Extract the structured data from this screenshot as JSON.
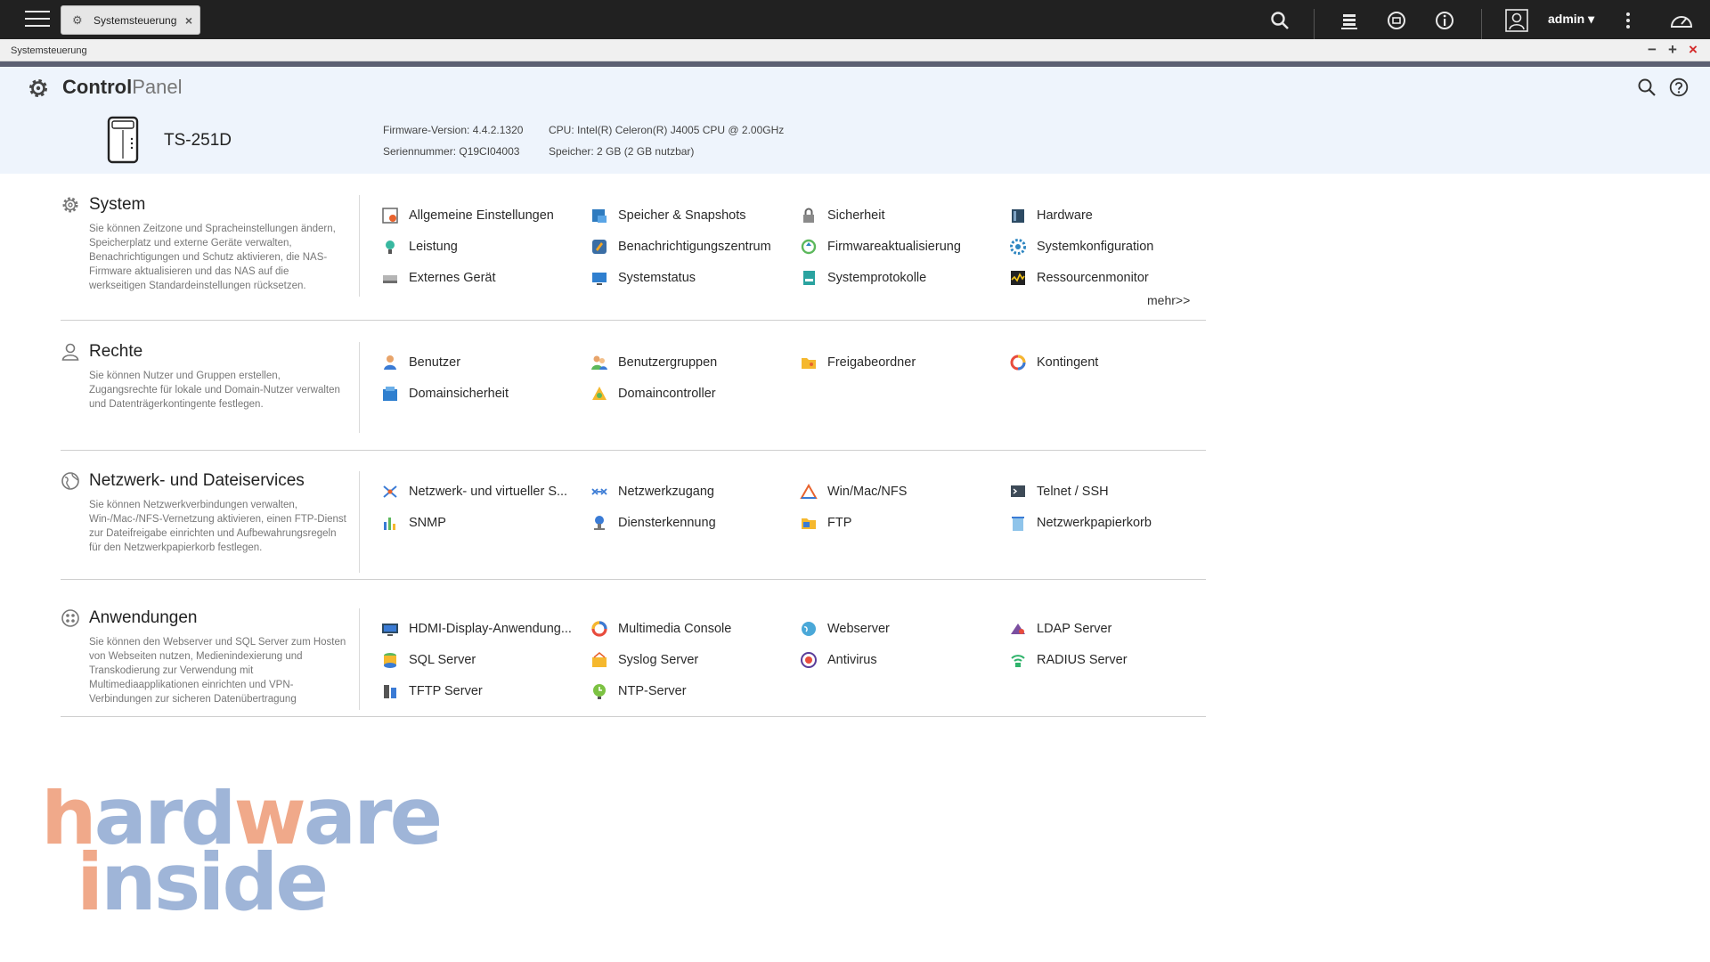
{
  "taskbar": {
    "tab_label": "Systemsteuerung",
    "user": "admin ▾"
  },
  "window": {
    "title": "Systemsteuerung",
    "controls": [
      "−",
      "+",
      "×"
    ]
  },
  "header": {
    "title_bold": "Control",
    "title_light": "Panel",
    "model": "TS-251D",
    "firmware_label": "Firmware-Version:",
    "firmware_value": "4.4.2.1320",
    "serial_label": "Seriennummer:",
    "serial_value": "Q19CI04003",
    "cpu_label": "CPU:",
    "cpu_value": "Intel(R) Celeron(R) J4005 CPU @ 2.00GHz",
    "memory_label": "Speicher:",
    "memory_value": "2 GB (2 GB nutzbar)"
  },
  "sections": [
    {
      "title": "System",
      "description": "Sie können Zeitzone und Spracheinstellungen ändern, Speicherplatz und externe Geräte verwalten, Benachrichtigungen und Schutz aktivieren, die NAS-Firmware aktualisieren und das NAS auf die werkseitigen Standardeinstellungen rücksetzen.",
      "items": [
        "Allgemeine Einstellungen",
        "Speicher & Snapshots",
        "Sicherheit",
        "Hardware",
        "Leistung",
        "Benachrichtigungszentrum",
        "Firmwareaktualisierung",
        "Systemkonfiguration",
        "Externes Gerät",
        "Systemstatus",
        "Systemprotokolle",
        "Ressourcenmonitor"
      ],
      "more": "mehr>>"
    },
    {
      "title": "Rechte",
      "description": "Sie können Nutzer und Gruppen erstellen, Zugangsrechte für lokale und Domain-Nutzer verwalten und Datenträgerkontingente festlegen.",
      "items": [
        "Benutzer",
        "Benutzergruppen",
        "Freigabeordner",
        "Kontingent",
        "Domainsicherheit",
        "Domaincontroller"
      ]
    },
    {
      "title": "Netzwerk- und Dateiservices",
      "description": "Sie können Netzwerkverbindungen verwalten, Win-/Mac-/NFS-Vernetzung aktivieren, einen FTP-Dienst zur Dateifreigabe einrichten und Aufbewahrungsregeln für den Netzwerkpapierkorb festlegen.",
      "items": [
        "Netzwerk- und virtueller S...",
        "Netzwerkzugang",
        "Win/Mac/NFS",
        "Telnet / SSH",
        "SNMP",
        "Diensterkennung",
        "FTP",
        "Netzwerkpapierkorb"
      ]
    },
    {
      "title": "Anwendungen",
      "description": "Sie können den Webserver und SQL Server zum Hosten von Webseiten nutzen, Medienindexierung und Transkodierung zur Verwendung mit Multimediaapplikationen einrichten und VPN-Verbindungen zur sicheren Datenübertragung",
      "items": [
        "HDMI-Display-Anwendung...",
        "Multimedia Console",
        "Webserver",
        "LDAP Server",
        "SQL Server",
        "Syslog Server",
        "Antivirus",
        "RADIUS Server",
        "TFTP Server",
        "NTP-Server"
      ]
    }
  ],
  "watermark": {
    "line1": "hardware",
    "line2": "inside"
  },
  "colors": {
    "taskbar": "#212121",
    "header_bg": "#eef4fc",
    "accent_bar": "#5b5f72",
    "watermark_orange": "#f0a98a",
    "watermark_blue": "#9fb5d8"
  }
}
